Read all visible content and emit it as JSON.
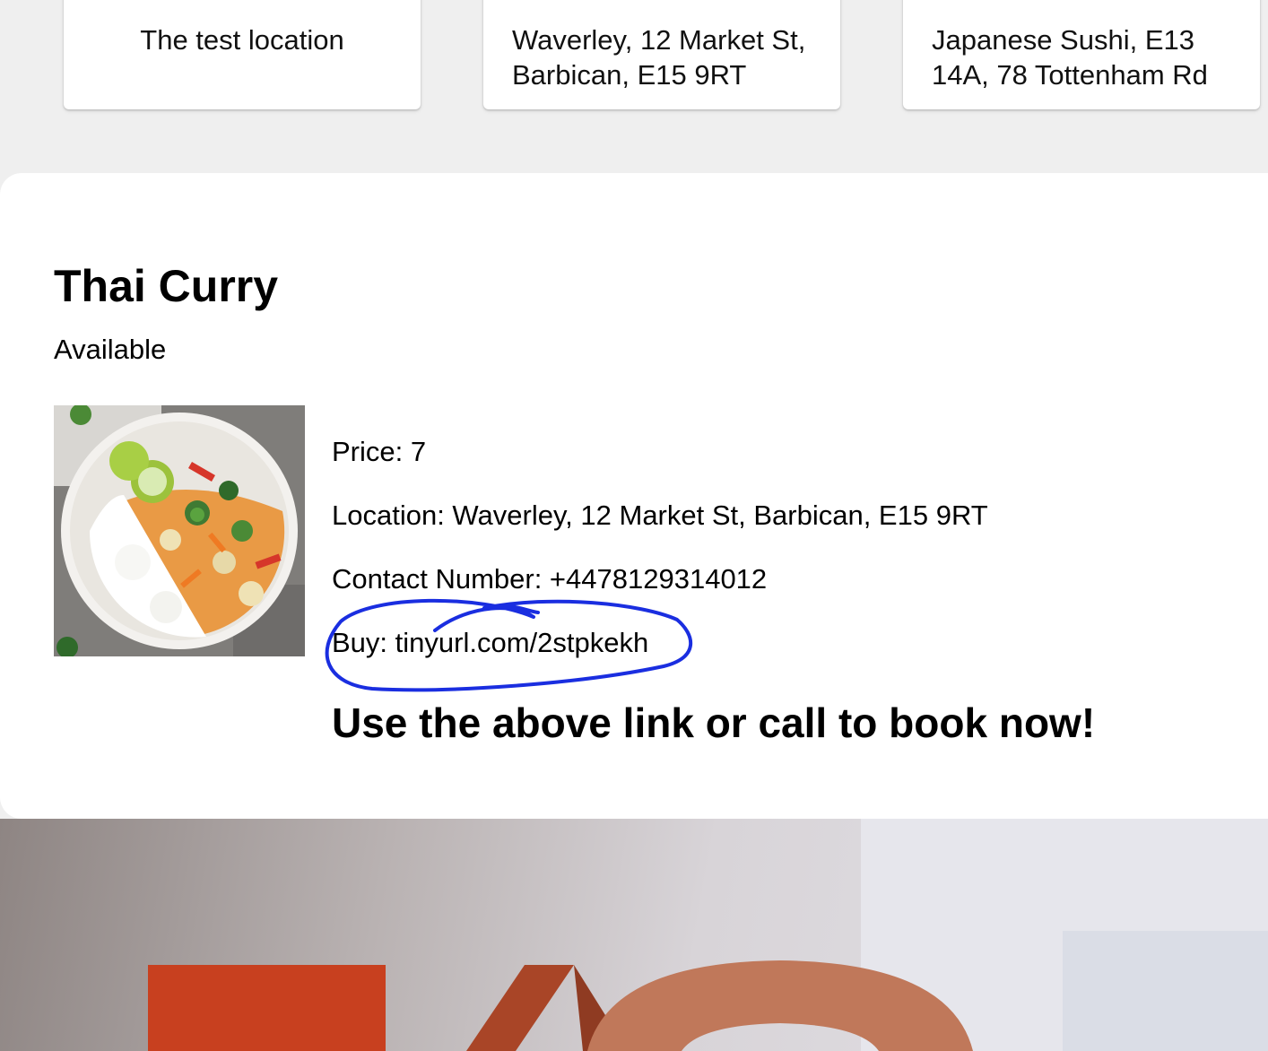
{
  "locations": [
    {
      "label": "The test location"
    },
    {
      "line1": "Waverley, 12 Market St,",
      "line2": "Barbican, E15 9RT"
    },
    {
      "line1": "Japanese Sushi, E13",
      "line2": "14A, 78 Tottenham Rd"
    }
  ],
  "product": {
    "title": "Thai Curry",
    "status": "Available",
    "image_icon": "thai-curry-photo",
    "price_label": "Price: 7",
    "location_label": "Location: Waverley, 12 Market St, Barbican, E15 9RT",
    "contact_label": "Contact Number: +4478129314012",
    "buy_label": "Buy: tinyurl.com/2stpkekh",
    "cta": "Use the above link or call to book now!"
  },
  "colors": {
    "annotation_circle": "#1a2ee0",
    "faq_letter_red": "#c8401f",
    "faq_letter_orange": "#c0785a"
  }
}
